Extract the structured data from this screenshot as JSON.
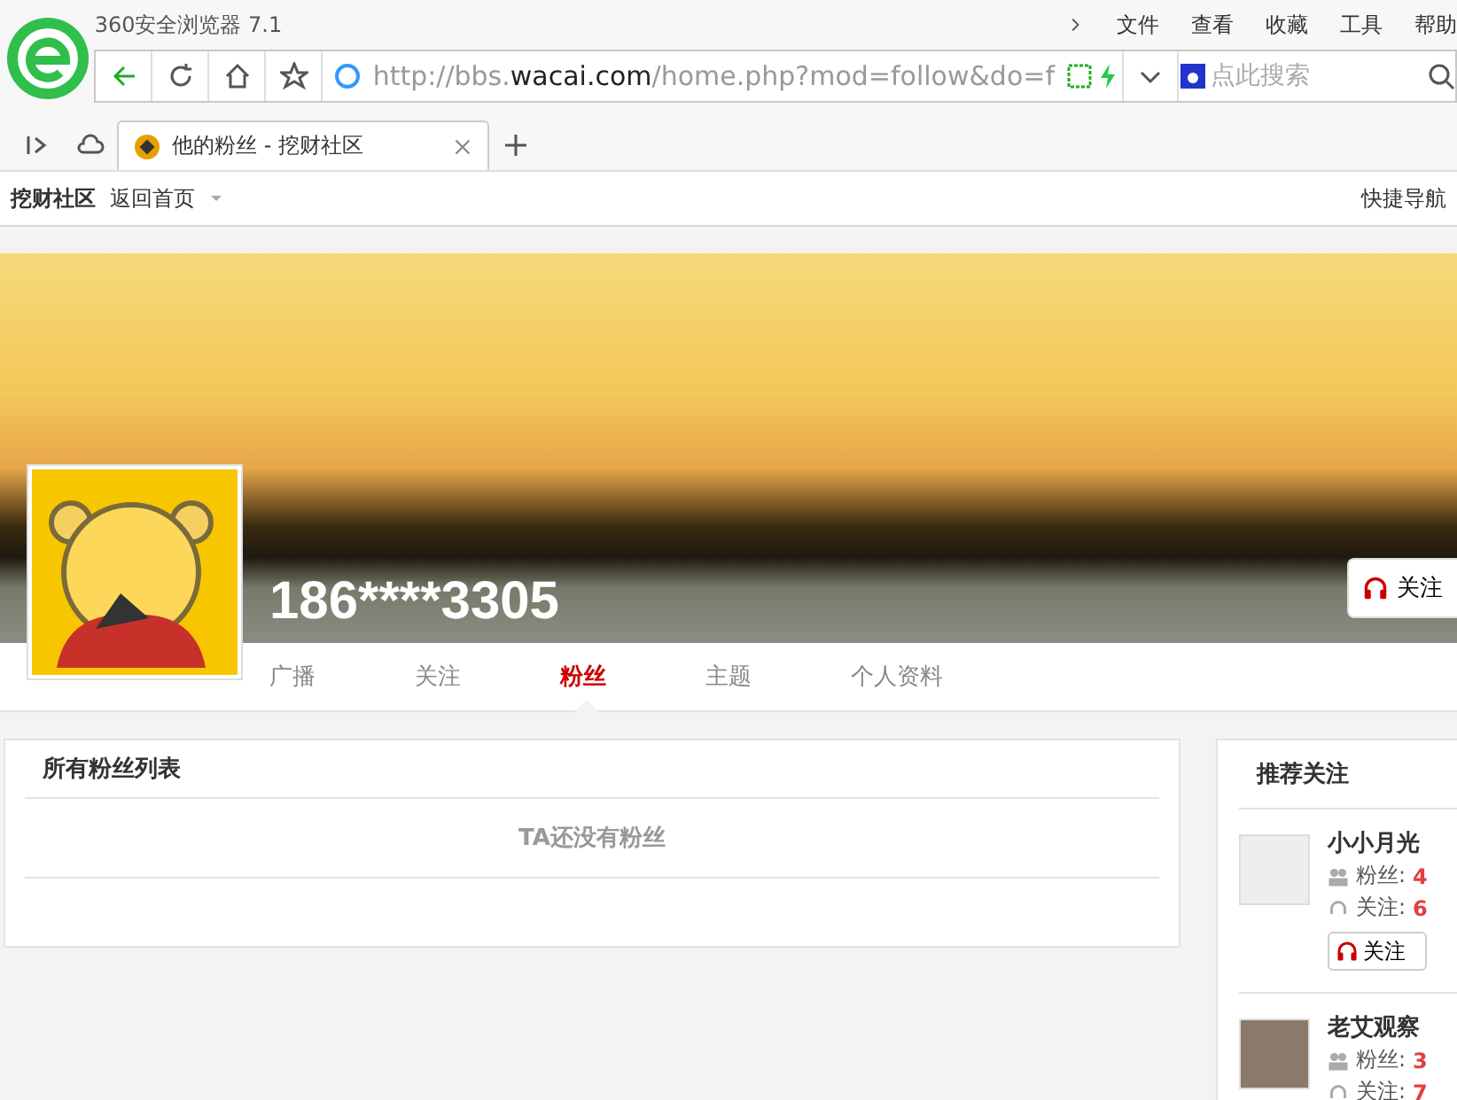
{
  "browser": {
    "title": "360安全浏览器 7.1",
    "menu": [
      "文件",
      "查看",
      "收藏",
      "工具",
      "帮助"
    ],
    "address": {
      "scheme": "http://bbs.",
      "domain": "wacai.com",
      "path": "/home.php?mod=follow&do=f"
    },
    "search": {
      "placeholder": "点此搜索"
    },
    "tabs": [
      {
        "label": "他的粉丝 - 挖财社区",
        "selected": true
      }
    ],
    "bookmarks": [
      "挖财社区",
      "返回首页"
    ],
    "quick_nav": "快捷导航"
  },
  "profile": {
    "username": "186****3305",
    "follow_button": "关注",
    "nav": [
      {
        "label": "广播",
        "selected": false
      },
      {
        "label": "关注",
        "selected": false
      },
      {
        "label": "粉丝",
        "selected": true
      },
      {
        "label": "主题",
        "selected": false
      },
      {
        "label": "个人资料",
        "selected": false
      }
    ]
  },
  "fans_panel": {
    "title": "所有粉丝列表",
    "empty_message": "TA还没有粉丝"
  },
  "recommend": {
    "title": "推荐关注",
    "users": [
      {
        "name": "小小月光",
        "fans_label": "粉丝:",
        "fans": "4",
        "follows_label": "关注:",
        "follows": "6",
        "button": "关注",
        "kind": "drawing"
      },
      {
        "name": "老艾观察",
        "fans_label": "粉丝:",
        "fans": "3",
        "follows_label": "关注:",
        "follows": "7",
        "kind": "photo"
      }
    ]
  }
}
